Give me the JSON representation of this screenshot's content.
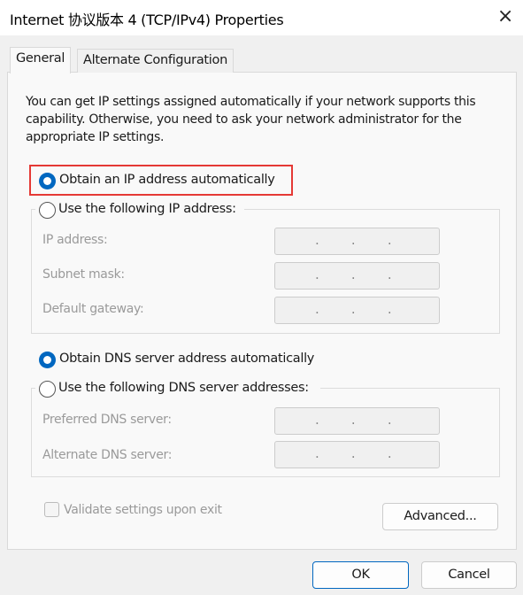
{
  "window": {
    "title": "Internet 协议版本 4 (TCP/IPv4) Properties",
    "close_icon": "×"
  },
  "tabs": [
    {
      "label": "General",
      "active": true
    },
    {
      "label": "Alternate Configuration",
      "active": false
    }
  ],
  "description": "You can get IP settings assigned automatically if your network supports this capability. Otherwise, you need to ask your network administrator for the appropriate IP settings.",
  "ip": {
    "auto_label": "Obtain an IP address automatically",
    "auto_selected": true,
    "manual_label": "Use the following IP address:",
    "fields": [
      {
        "label": "IP address:",
        "value": ". . ."
      },
      {
        "label": "Subnet mask:",
        "value": ". . ."
      },
      {
        "label": "Default gateway:",
        "value": ". . ."
      }
    ]
  },
  "dns": {
    "auto_label": "Obtain DNS server address automatically",
    "auto_selected": true,
    "manual_label": "Use the following DNS server addresses:",
    "fields": [
      {
        "label": "Preferred DNS server:",
        "value": ". . ."
      },
      {
        "label": "Alternate DNS server:",
        "value": ". . ."
      }
    ]
  },
  "validate": {
    "label": "Validate settings upon exit",
    "checked": false
  },
  "buttons": {
    "advanced": "Advanced...",
    "ok": "OK",
    "cancel": "Cancel"
  },
  "colors": {
    "accent": "#0067c0",
    "highlight": "#e53935"
  }
}
